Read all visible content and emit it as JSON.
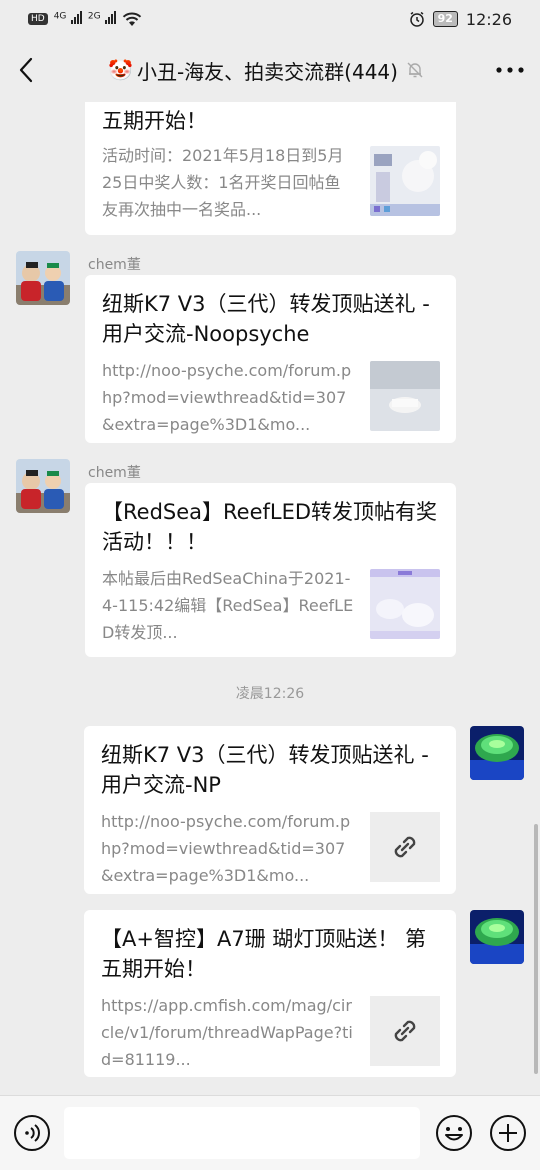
{
  "status_bar": {
    "hd": "HD",
    "net1": "4G",
    "net2": "2G",
    "battery": "92",
    "time": "12:26"
  },
  "header": {
    "title": "小丑-海友、拍卖交流群(444)",
    "emoji": "🤡"
  },
  "messages": [
    {
      "title": "五期开始！",
      "desc": "活动时间：2021年5月18日到5月25日中奖人数：1名开奖日回帖鱼友再次抽中一名奖品..."
    },
    {
      "sender": "chem董",
      "title": "纽斯K7 V3（三代）转发顶贴送礼 - 用户交流-Noopsyche",
      "desc": "http://noo-psyche.com/forum.php?mod=viewthread&tid=307&extra=page%3D1&mo..."
    },
    {
      "sender": "chem董",
      "title": "【RedSea】ReefLED转发顶帖有奖活动！！！",
      "desc": "本帖最后由RedSeaChina于2021-4-115:42编辑【RedSea】ReefLED转发顶..."
    },
    {
      "title": "纽斯K7 V3（三代）转发顶贴送礼 - 用户交流-NP",
      "desc": "http://noo-psyche.com/forum.php?mod=viewthread&tid=307&extra=page%3D1&mo..."
    },
    {
      "title": "【A+智控】A7珊 瑚灯顶贴送！ 第五期开始！",
      "desc": "https://app.cmfish.com/mag/circle/v1/forum/threadWapPage?tid=81119..."
    }
  ],
  "time_separator": "凌晨12:26",
  "icons": {
    "back": "back-arrow-icon",
    "mute": "mute-bell-icon",
    "more": "more-dots-icon",
    "link": "link-icon",
    "voice": "voice-icon",
    "emoji": "emoji-icon",
    "plus": "plus-icon"
  }
}
